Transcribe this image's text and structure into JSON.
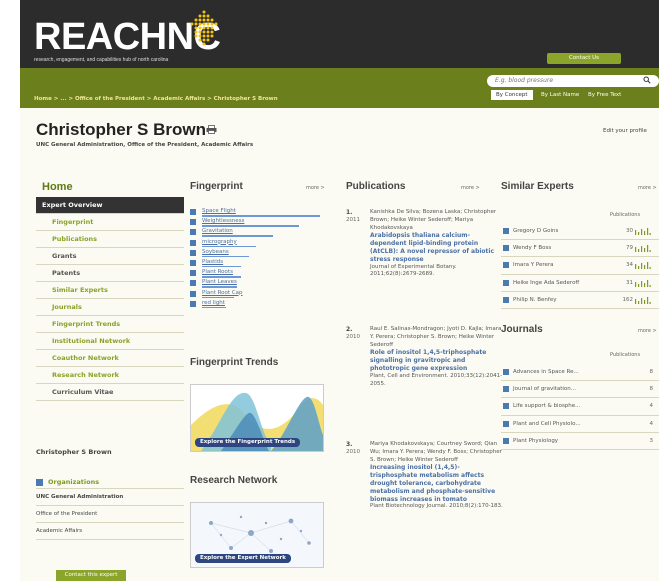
{
  "header": {
    "logo_text": "REACHNC",
    "tagline": "research, engagement, and capabilities hub of north carolina",
    "contact_us": "Contact Us",
    "breadcrumb": "Home > ... > Office of the President > Academic Affairs > Christopher S Brown",
    "search_placeholder": "E.g. blood pressure",
    "search_options": [
      "By Concept",
      "By Last Name",
      "By Free Text"
    ]
  },
  "profile": {
    "name": "Christopher S Brown",
    "affiliation": "UNC General Administration, Office of the President, Academic Affairs",
    "edit_link": "Edit your profile"
  },
  "sidebar": {
    "home": "Home",
    "items": [
      {
        "label": "Expert Overview",
        "state": "active"
      },
      {
        "label": "Fingerprint",
        "state": "link"
      },
      {
        "label": "Publications",
        "state": "link"
      },
      {
        "label": "Grants",
        "state": "grey"
      },
      {
        "label": "Patents",
        "state": "grey"
      },
      {
        "label": "Similar Experts",
        "state": "link"
      },
      {
        "label": "Journals",
        "state": "link"
      },
      {
        "label": "Fingerprint Trends",
        "state": "link"
      },
      {
        "label": "Institutional Network",
        "state": "link"
      },
      {
        "label": "Coauthor Network",
        "state": "link"
      },
      {
        "label": "Research Network",
        "state": "link"
      },
      {
        "label": "Curriculum Vitae",
        "state": "grey"
      }
    ],
    "person_name": "Christopher S Brown",
    "organizations_label": "Organizations",
    "organizations": [
      "UNC General Administration",
      "Office of the President",
      "Academic Affairs"
    ],
    "contact_expert": "Contact this expert"
  },
  "fingerprint": {
    "title": "Fingerprint",
    "more": "more >",
    "items": [
      {
        "label": "Space Flight",
        "weight": 1.0
      },
      {
        "label": "Weightlessness",
        "weight": 0.82
      },
      {
        "label": "Gravitation",
        "weight": 0.6
      },
      {
        "label": "micrography",
        "weight": 0.46
      },
      {
        "label": "Soybeans",
        "weight": 0.4
      },
      {
        "label": "Plastids",
        "weight": 0.33
      },
      {
        "label": "Plant Roots",
        "weight": 0.33
      },
      {
        "label": "Plant Leaves",
        "weight": 0.3
      },
      {
        "label": "Plant Root Cap",
        "weight": 0.27
      },
      {
        "label": "red light",
        "weight": 0.2
      }
    ]
  },
  "fingerprint_trends": {
    "title": "Fingerprint Trends",
    "caption": "Explore the Fingerprint Trends"
  },
  "research_network": {
    "title": "Research Network",
    "caption": "Explore the Expert Network"
  },
  "publications": {
    "title": "Publications",
    "more": "more >",
    "items": [
      {
        "num": "1.",
        "year": "2011",
        "authors": "Kanishka De Silva; Bozena Laska; Christopher Brown; Heike Winter Sederoff; Mariya Khodakovskaya",
        "title": "Arabidopsis thaliana calcium-dependent lipid-binding protein (AtCLB): A novel repressor of abiotic stress response",
        "source": "Journal of Experimental Botany. 2011;62(8):2679-2689."
      },
      {
        "num": "2.",
        "year": "2010",
        "authors": "Raul E. Salinas-Mondragon; Jyoti D. Kajla; Imara Y. Perera; Christopher S. Brown; Heike Winter Sederoff",
        "title": "Role of inositol 1,4,5-triphosphate signalling in gravitropic and phototropic gene expression",
        "source": "Plant, Cell and Environment. 2010;33(12):2041-2055."
      },
      {
        "num": "3.",
        "year": "2010",
        "authors": "Mariya Khodakovskaya; Courtney Sword; Qian Wu; Imara Y. Perera; Wendy F. Boss; Christopher S. Brown; Heike Winter Sederoff",
        "title": "Increasing inositol (1,4,5)-trisphosphate metabolism affects drought tolerance, carbohydrate metabolism and phosphate-sensitive biomass increases in tomato",
        "source": "Plant Biotechnology Journal. 2010;8(2):170-183."
      }
    ]
  },
  "similar_experts": {
    "title": "Similar Experts",
    "more": "more >",
    "column_label": "Publications",
    "items": [
      {
        "name": "Gregory D Goins",
        "count": "30"
      },
      {
        "name": "Wendy F Boss",
        "count": "79"
      },
      {
        "name": "Imara Y Perera",
        "count": "34"
      },
      {
        "name": "Heike Inge Ada Sederoff",
        "count": "31"
      },
      {
        "name": "Philip N. Benfey",
        "count": "162"
      }
    ]
  },
  "journals": {
    "title": "Journals",
    "more": "more >",
    "column_label": "Publications",
    "items": [
      {
        "name": "Advances in Space Re...",
        "count": "8"
      },
      {
        "name": "Journal of gravitation...",
        "count": "8"
      },
      {
        "name": "Life support & biosphe...",
        "count": "4"
      },
      {
        "name": "Plant and Cell Physiolo...",
        "count": "4"
      },
      {
        "name": "Plant Physiology",
        "count": "3"
      }
    ]
  },
  "colors": {
    "header_bg": "#2c2c2c",
    "nav_bg": "#6c7f1d",
    "accent_green": "#8ba52a",
    "link_blue": "#4b6fa6",
    "logo_dots": "#f2c20e"
  }
}
